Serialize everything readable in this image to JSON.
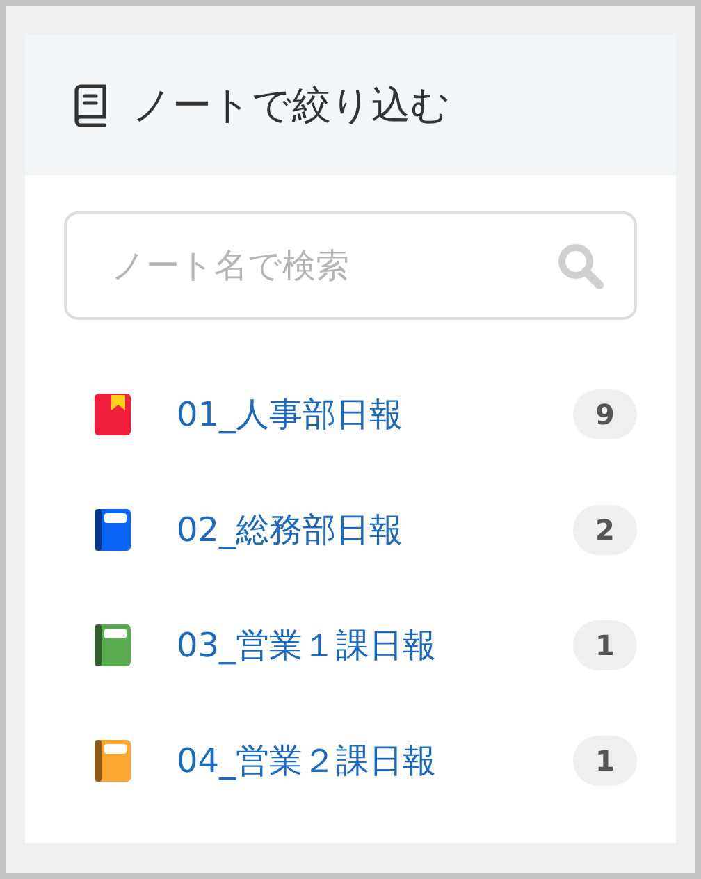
{
  "panel": {
    "title": "ノートで絞り込む"
  },
  "search": {
    "placeholder": "ノート名で検索"
  },
  "notes": [
    {
      "name": "01_人事部日報",
      "count": "9",
      "kind": "bookmark",
      "color": "#f21c3c"
    },
    {
      "name": "02_総務部日報",
      "count": "2",
      "kind": "notebook",
      "color": "#0a64f5"
    },
    {
      "name": "03_営業１課日報",
      "count": "1",
      "kind": "notebook",
      "color": "#5aab50"
    },
    {
      "name": "04_営業２課日報",
      "count": "1",
      "kind": "notebook",
      "color": "#fca530"
    }
  ]
}
